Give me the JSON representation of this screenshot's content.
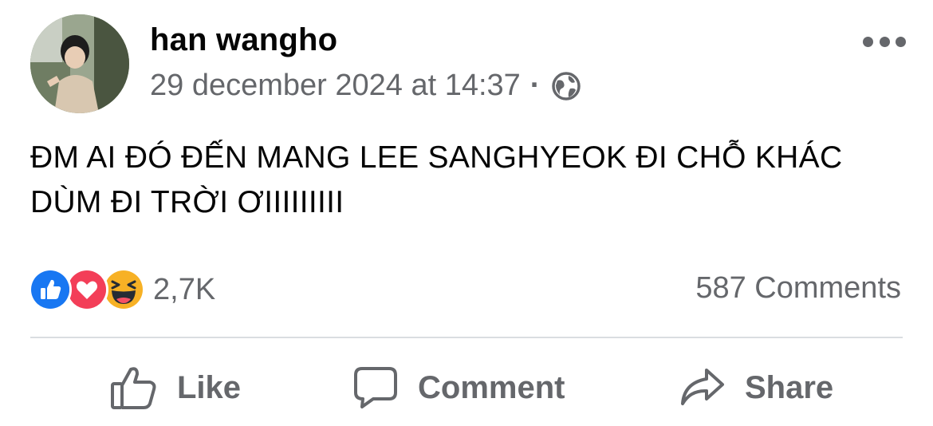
{
  "post": {
    "author": "han wangho",
    "timestamp": "29 december 2024 at 14:37",
    "separator": "·",
    "privacy_icon": "globe-icon",
    "text": "ĐM AI ĐÓ ĐẾN MANG LEE SANGHYEOK ĐI CHỖ KHÁC DÙM ĐI TRỜI ƠIIIIIIIII"
  },
  "reactions": {
    "icons": [
      "like-reaction-icon",
      "love-reaction-icon",
      "haha-reaction-icon"
    ],
    "count": "2,7K"
  },
  "comments": {
    "label": "587 Comments"
  },
  "actions": {
    "like": {
      "label": "Like",
      "icon": "thumbs-up-icon"
    },
    "comment": {
      "label": "Comment",
      "icon": "speech-bubble-icon"
    },
    "share": {
      "label": "Share",
      "icon": "share-arrow-icon"
    }
  },
  "colors": {
    "like_blue": "#1877f2",
    "love_red": "#f33e58",
    "haha_yellow": "#f7b125",
    "secondary_text": "#65676b"
  }
}
